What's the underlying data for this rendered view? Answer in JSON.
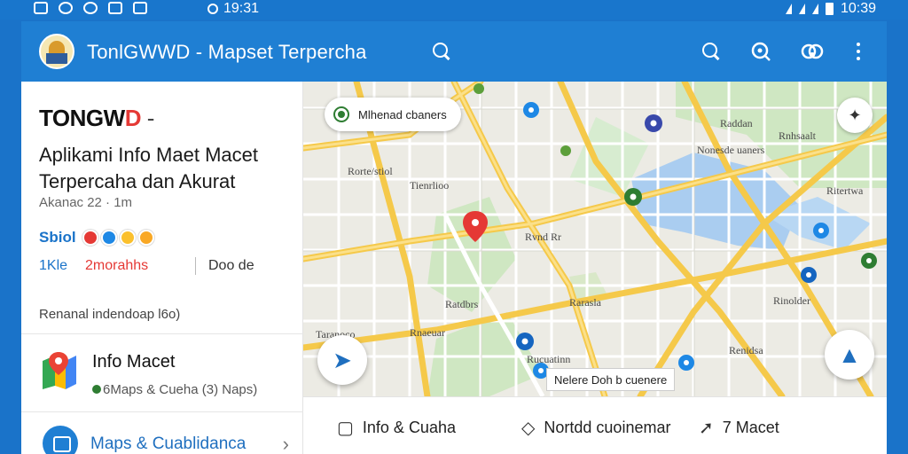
{
  "status_bar": {
    "time_left": "19:31",
    "time_right": "10:39",
    "icons_left": [
      "photo-icon",
      "messenger-icon",
      "shield-icon",
      "gallery-icon",
      "app-icon"
    ],
    "icons_right": [
      "wifi-icon",
      "signal-icon",
      "signal-icon",
      "battery-icon"
    ]
  },
  "appbar": {
    "title": "TonlGWWD - Mapset Terpercha",
    "icons": [
      "search-icon",
      "search-icon",
      "zoom-icon",
      "share-icon",
      "more-vert-icon"
    ]
  },
  "panel": {
    "brand_main": "TONGW",
    "brand_accent": "D",
    "brand_dash": " -",
    "headline": "Aplikami Info Maet Macet Terpercaha dan Akurat",
    "subline": "Akanac 22 · 1m",
    "rating_label": "Sbiol",
    "rating_colors": [
      "#e53935",
      "#1e88e5",
      "#fbc02d",
      "#f9a825"
    ],
    "stat_a": "1Kle",
    "stat_b": "2morahhs",
    "stat_c": "Doo de",
    "reviews": "Renanal indendoap l6o)",
    "list_item": {
      "title": "Info Macet",
      "badge": "6",
      "subtitle": "Maps & Cueha  (3) Naps)"
    },
    "nav_item": {
      "label": "Maps & Cuablidanca"
    }
  },
  "map": {
    "chip": "Mlhenad cbaners",
    "callout": "Nelere Doh b cuenere",
    "labels": [
      "Rnhsaalt",
      "Nonesde uaners",
      "Rorte/stiol",
      "Tienrlioo",
      "Ritertwa",
      "Rvnd Rr",
      "Ratdbrs",
      "Rarasla",
      "Rinolder",
      "Renidsa",
      "Taranoco",
      "Rnaeuar",
      "Rucuatinn",
      "Raddan"
    ]
  },
  "actions": [
    {
      "icon": "chat-icon",
      "label": "Info & Cuaha"
    },
    {
      "icon": "tag-icon",
      "label": "Nortdd cuoinemar"
    },
    {
      "icon": "direction-icon",
      "label": "7 Macet"
    }
  ]
}
